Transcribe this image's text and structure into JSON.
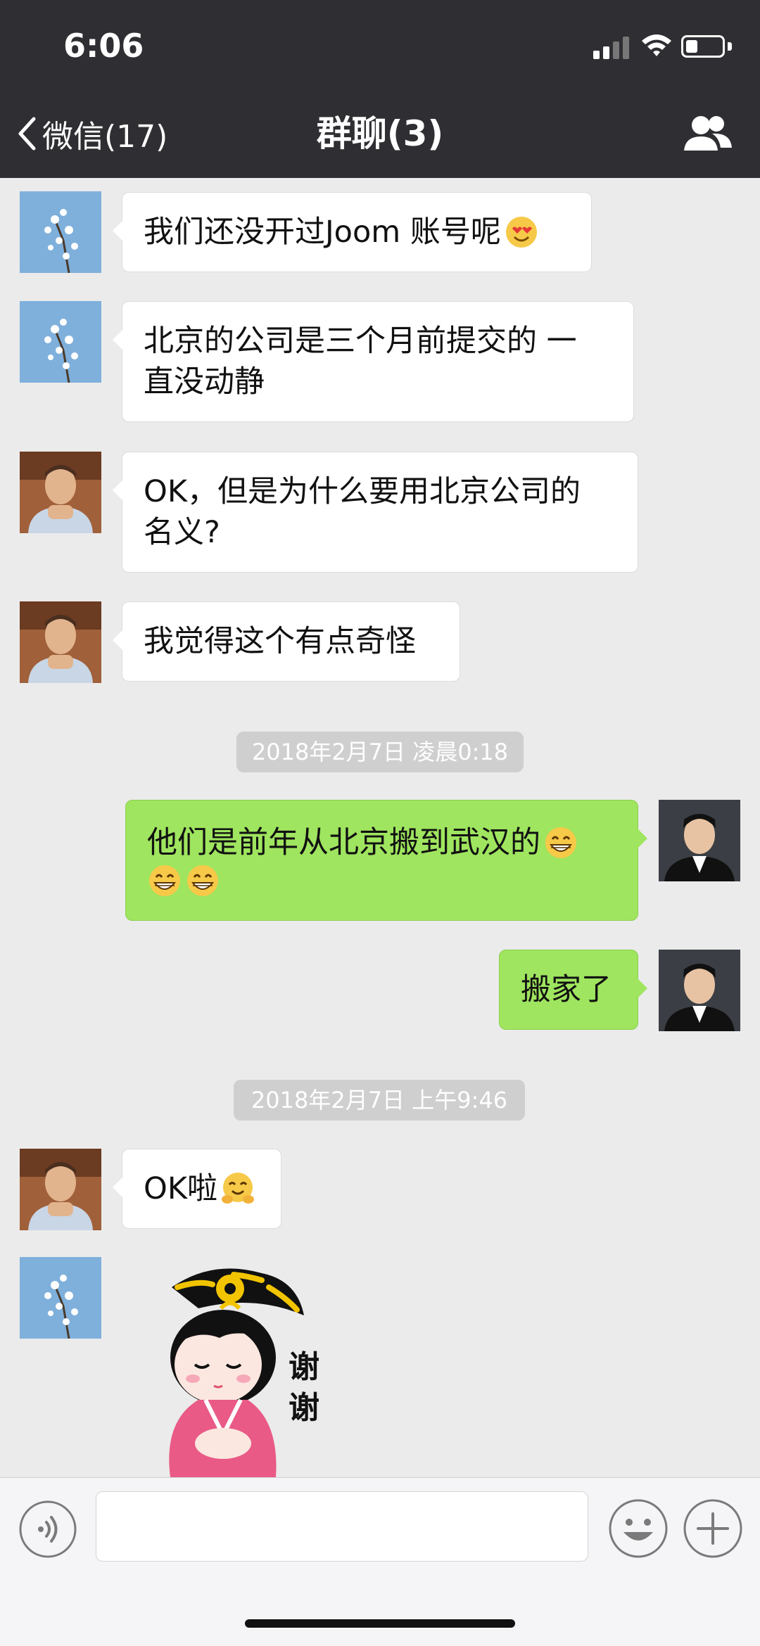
{
  "status_bar": {
    "time": "6:06"
  },
  "nav": {
    "back_label": "微信(17)",
    "title": "群聊(3)"
  },
  "messages": [
    {
      "side": "in",
      "lines": [
        "我们还没开过Joom 账号呢"
      ],
      "emoji": "heart-eyes-emoji"
    },
    {
      "side": "in",
      "lines": [
        "北京的公司是三个月前提交的 一",
        "直没动静"
      ]
    },
    {
      "side": "in",
      "lines": [
        "OK，但是为什么要用北京公司的",
        "名义?"
      ]
    },
    {
      "side": "in",
      "lines": [
        "我觉得这个有点奇怪"
      ]
    },
    {
      "side": "out",
      "lines": [
        "他们是前年从北京搬到武汉的"
      ],
      "emoji": "grin-emoji"
    },
    {
      "side": "out",
      "lines": [
        "搬家了"
      ]
    },
    {
      "side": "in",
      "lines": [
        "OK啦"
      ],
      "emoji": "hug-emoji"
    }
  ],
  "timestamps": [
    "2018年2月7日 凌晨0:18",
    "2018年2月7日 上午9:46"
  ],
  "sticker": {
    "icon": "thank-you-sticker",
    "text": "谢谢"
  },
  "input_bar": {
    "text_value": ""
  },
  "colors": {
    "header": "#2f2f33",
    "background": "#ebebeb",
    "outgoing_bubble": "#9fe55f",
    "incoming_bubble": "#ffffff"
  }
}
